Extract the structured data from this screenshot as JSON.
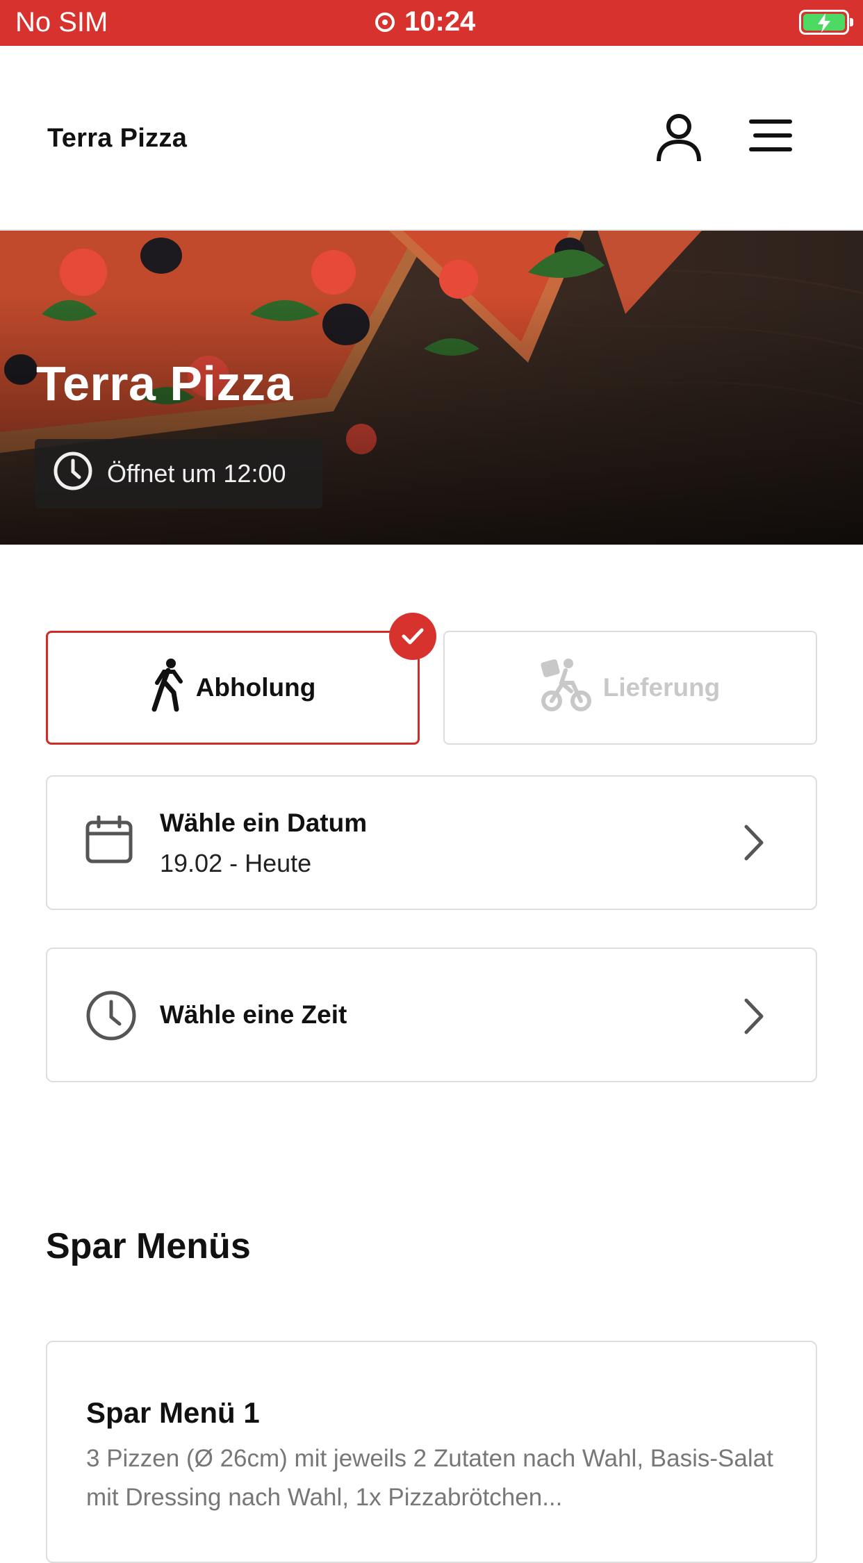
{
  "status_bar": {
    "carrier": "No SIM",
    "time": "10:24",
    "battery_charging": true,
    "bar_color": "#d8322e"
  },
  "header": {
    "brand": "Terra Pizza",
    "account_icon": "person-icon",
    "menu_icon": "hamburger-menu-icon"
  },
  "hero": {
    "title": "Terra Pizza",
    "opening_text": "Öffnet um 12:00"
  },
  "order_type": {
    "pickup_label": "Abholung",
    "delivery_label": "Lieferung",
    "selected": "pickup",
    "accent_color": "#d8322e"
  },
  "date_picker": {
    "title": "Wähle ein Datum",
    "value": "19.02 - Heute"
  },
  "time_picker": {
    "title": "Wähle eine Zeit"
  },
  "sections": {
    "spar_title": "Spar Menüs"
  },
  "menu_items": [
    {
      "title": "Spar Menü 1",
      "description": "3 Pizzen (Ø 26cm) mit jeweils 2 Zutaten nach Wahl, Basis-Salat mit Dressing nach Wahl, 1x Pizzabrötchen..."
    }
  ]
}
